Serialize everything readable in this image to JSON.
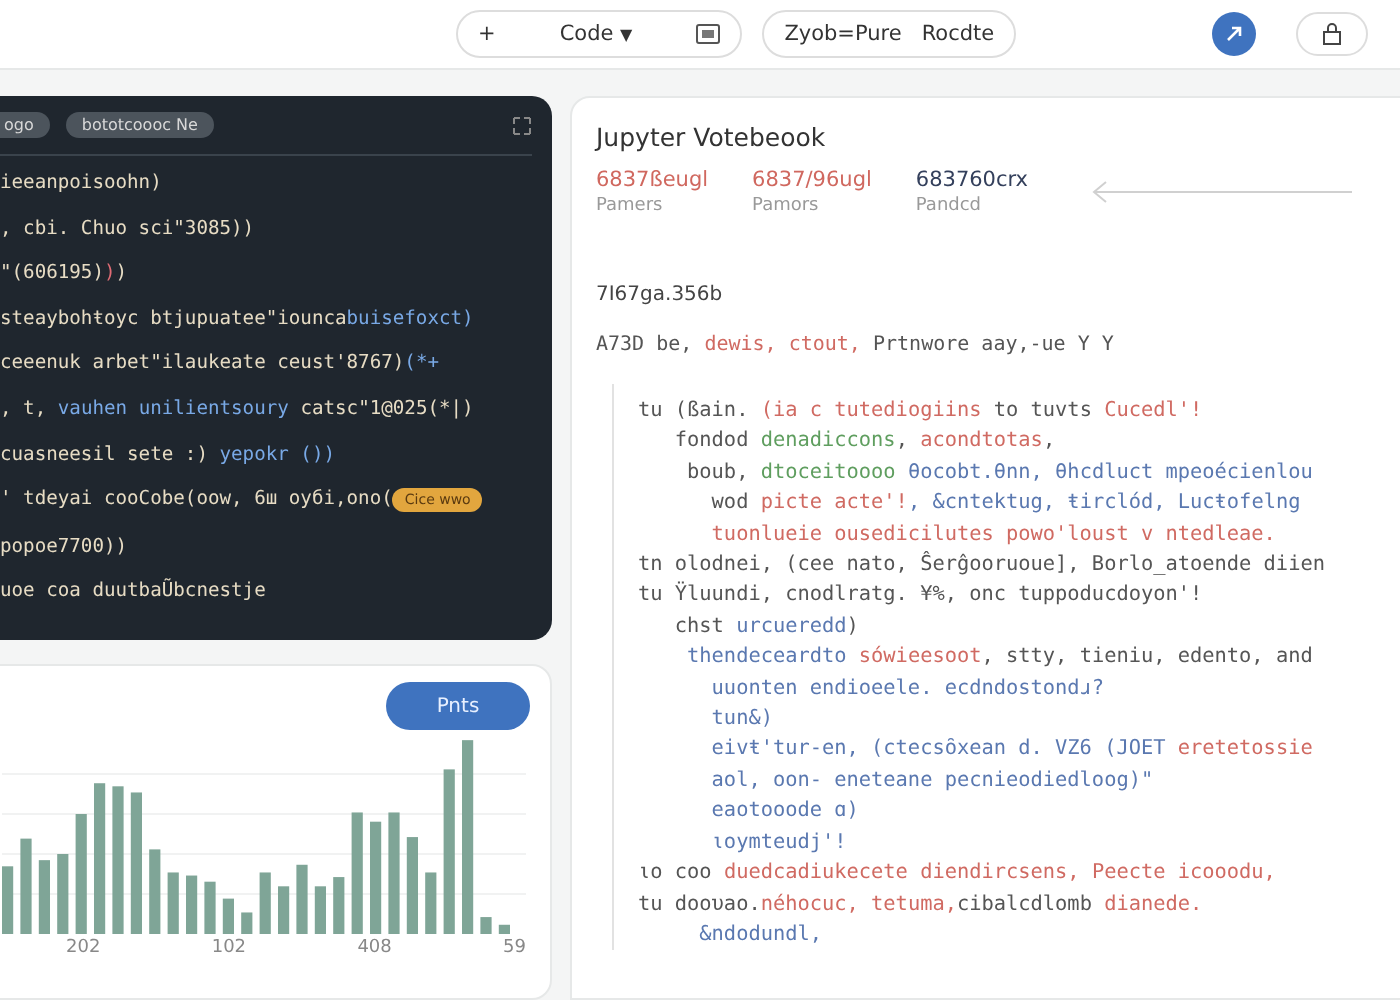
{
  "toolbar": {
    "add": "+",
    "cell_type": "Code",
    "caret": "▼",
    "kernel": "Zyob=Pure",
    "mode": "Rocdte"
  },
  "code_panel": {
    "tabs": [
      "ogo",
      "bototcoooc Ne"
    ],
    "lines": [
      [
        {
          "text": "ieeanpoisoohn)",
          "kind": "plain"
        }
      ],
      [
        {
          "text": ", cbi. Chuo sci\"3085))",
          "kind": "plain"
        }
      ],
      [
        {
          "text": "\"(606195)",
          "kind": "plain"
        },
        {
          "text": ")",
          "kind": "red"
        },
        {
          "text": ")",
          "kind": "plain"
        }
      ],
      [
        {
          "text": "steaybohŧoyc btjupuatee\"iounca",
          "kind": "plain"
        },
        {
          "text": "buisefoxct)",
          "kind": "blue"
        }
      ],
      [
        {
          "text": "ceeenuk arbet\"ilaukeate ceust'8767)",
          "kind": "plain"
        },
        {
          "text": "(*+",
          "kind": "blue"
        }
      ],
      [
        {
          "text": ", t, ",
          "kind": "plain"
        },
        {
          "text": "vauhen unilientsoury",
          "kind": "blue"
        },
        {
          "text": " catsc\"1@025(*|)",
          "kind": "plain"
        }
      ],
      [
        {
          "text": "cuasneesil sete :) ",
          "kind": "plain"
        },
        {
          "text": "yepokr ())",
          "kind": "blue"
        }
      ],
      [
        {
          "text": "' tdeyai cooCobe(oow, 6ш oyбi,ono(",
          "kind": "plain"
        },
        {
          "text": "Cice wwo",
          "kind": "badge"
        }
      ],
      [
        {
          "text": "popoe7700))",
          "kind": "plain"
        }
      ],
      [
        {
          "text": "uoe coa duutbaŨbcnestje",
          "kind": "plain"
        }
      ]
    ]
  },
  "chart_panel": {
    "button": "Pnts",
    "axis_labels": [
      "202",
      "102",
      "408",
      "59"
    ]
  },
  "notebook": {
    "title": "Jupyter Votebeook",
    "stats": [
      {
        "value": "6837ßeugl",
        "label": "Pamers",
        "color": "#d0685f"
      },
      {
        "value": "6837/96ugl",
        "label": "Pamors",
        "color": "#d0685f"
      },
      {
        "value": "683760crx",
        "label": "Pandcd",
        "color": "#34405c"
      }
    ],
    "id": "7I67ga.356b",
    "summary": [
      {
        "text": "A73D be, ",
        "kind": "plain"
      },
      {
        "text": "dewis, ctout,",
        "kind": "red"
      },
      {
        "text": " Prtnwore aay,-ue Y Y",
        "kind": "plain"
      }
    ],
    "lines": [
      [
        {
          "text": "tu (ßain. ",
          "kind": "plain"
        },
        {
          "text": "(ia c tutediogiins",
          "kind": "red"
        },
        {
          "text": " to tuvts ",
          "kind": "plain"
        },
        {
          "text": "Cucedl'!",
          "kind": "red"
        }
      ],
      [
        {
          "text": "   fondod ",
          "kind": "plain"
        },
        {
          "text": "denadiccons",
          "kind": "green"
        },
        {
          "text": ", ",
          "kind": "plain"
        },
        {
          "text": "acondtotas",
          "kind": "red"
        },
        {
          "text": ",",
          "kind": "plain"
        }
      ],
      [
        {
          "text": "    boub, ",
          "kind": "plain"
        },
        {
          "text": "dtoceitoooo",
          "kind": "green"
        },
        {
          "text": " θocobt.θnn, θhcdluct mpeoécienlou",
          "kind": "blue"
        }
      ],
      [
        {
          "text": "      wod ",
          "kind": "plain"
        },
        {
          "text": "picte acte'!",
          "kind": "red"
        },
        {
          "text": ", &cntektug, ŧirclód, Lucŧofelng",
          "kind": "blue"
        }
      ],
      [
        {
          "text": "      tuonlueie ousedicilutes powo'loust v ntedleae.",
          "kind": "red"
        }
      ],
      [
        {
          "text": "tn olodnei, (cee nato, Ŝerĝooruoue], Borlo_atoende diien",
          "kind": "plain"
        }
      ],
      [
        {
          "text": "tu Ÿluundi, cnodlratg. ¥%, onc tuppoducdoyon'!",
          "kind": "plain"
        }
      ],
      [
        {
          "text": "   chst ",
          "kind": "plain"
        },
        {
          "text": "urcueredd",
          "kind": "blue"
        },
        {
          "text": ")",
          "kind": "plain"
        }
      ],
      [
        {
          "text": "    thendeceardto ",
          "kind": "blue"
        },
        {
          "text": "sówieesoot",
          "kind": "red"
        },
        {
          "text": ", stty, tieniu, edento, and",
          "kind": "plain"
        }
      ],
      [
        {
          "text": "      uuonten endioeele. ecdndostondɹ?",
          "kind": "blue"
        }
      ],
      [
        {
          "text": "      tun&)",
          "kind": "blue"
        }
      ],
      [
        {
          "text": "      eivŧ'tur-en, (ctecsȏxean d. VZ6 (JOET ",
          "kind": "blue"
        },
        {
          "text": "eretetossie",
          "kind": "red"
        }
      ],
      [
        {
          "text": "      aol, oon- eneteane pecnieodiedloog)\"",
          "kind": "blue"
        }
      ],
      [
        {
          "text": "      eaotooode ɑ)",
          "kind": "blue"
        }
      ],
      [
        {
          "text": "      ιoymteudj'!",
          "kind": "blue"
        }
      ],
      [
        {
          "text": "ιo coo ",
          "kind": "plain"
        },
        {
          "text": "duedcadiukecete diendircsens, Peecte icooodu,",
          "kind": "red"
        }
      ],
      [
        {
          "text": "tu dooυao.",
          "kind": "plain"
        },
        {
          "text": "néhocuc, tetuma,",
          "kind": "red"
        },
        {
          "text": "cibalcdlomb ",
          "kind": "plain"
        },
        {
          "text": "dianede.",
          "kind": "red"
        }
      ],
      [
        {
          "text": "     &ndodundl,",
          "kind": "blue"
        }
      ]
    ]
  }
}
